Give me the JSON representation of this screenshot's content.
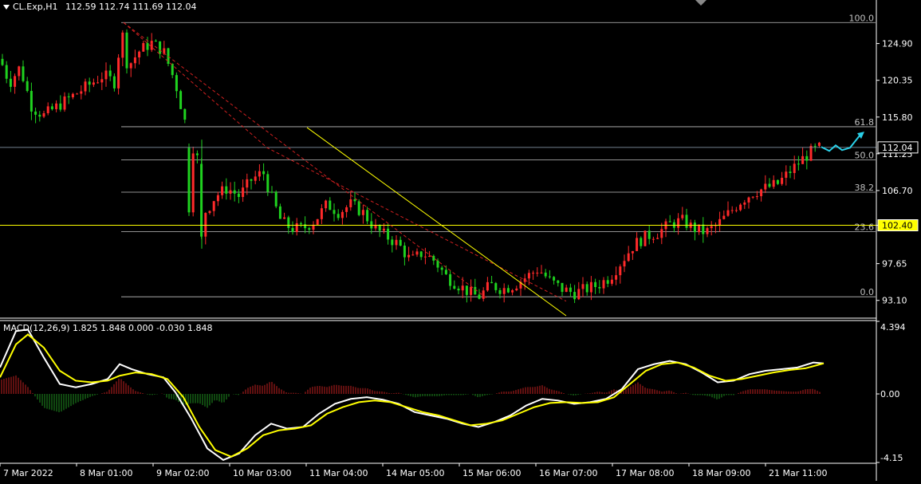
{
  "header": {
    "symbol": "CL.Exp,H1",
    "ohlc": "112.59 112.74 111.69 112.04"
  },
  "macd_header": "MACD(12,26,9) 1.825 1.848 0.000 -0.030 1.848",
  "colors": {
    "background": "#000000",
    "bull_candle": "#ff2a2a",
    "bear_candle": "#1fd21f",
    "grid": "#c0c0c0",
    "yellow": "#ffff00",
    "macd_main": "#ffffff",
    "macd_signal": "#ffff00",
    "macd_pos": "#c02020",
    "macd_neg": "#1f8f1f",
    "projection": "#2ad0e8"
  },
  "chart_data": [
    {
      "type": "candlestick",
      "instrument": "CL.Exp",
      "timeframe": "H1",
      "ylim": [
        91.0,
        129.5
      ],
      "y_ticks": [
        "124.90",
        "120.35",
        "115.80",
        "111.25",
        "106.70",
        "102.40",
        "97.65",
        "93.10"
      ],
      "price_tags": [
        {
          "label": "112.04",
          "value": 112.04
        },
        {
          "label": "102.40",
          "value": 102.4
        }
      ],
      "x_ticks": [
        "7 Mar 2022",
        "8 Mar 01:00",
        "9 Mar 02:00",
        "10 Mar 03:00",
        "11 Mar 04:00",
        "14 Mar 05:00",
        "15 Mar 06:00",
        "16 Mar 07:00",
        "17 Mar 08:00",
        "18 Mar 09:00",
        "21 Mar 11:00"
      ],
      "fibonacci": {
        "high": 127.5,
        "low": 93.55,
        "levels": [
          {
            "label": "100.0",
            "value": 127.5
          },
          {
            "label": "61.8",
            "value": 114.6
          },
          {
            "label": "50.0",
            "value": 110.5
          },
          {
            "label": "38.2",
            "value": 106.5
          },
          {
            "label": "23.6",
            "value": 101.6
          },
          {
            "label": "0.0",
            "value": 93.55
          }
        ]
      },
      "close_path": [
        [
          0,
          123
        ],
        [
          12,
          120
        ],
        [
          25,
          122
        ],
        [
          40,
          117
        ],
        [
          55,
          116
        ],
        [
          70,
          117
        ],
        [
          85,
          118
        ],
        [
          100,
          119
        ],
        [
          115,
          120
        ],
        [
          130,
          121
        ],
        [
          145,
          120
        ],
        [
          152,
          127
        ],
        [
          160,
          122
        ],
        [
          175,
          124
        ],
        [
          190,
          125
        ],
        [
          205,
          124
        ],
        [
          220,
          120
        ],
        [
          235,
          114
        ],
        [
          250,
          110
        ],
        [
          258,
          104
        ],
        [
          270,
          106
        ],
        [
          285,
          107
        ],
        [
          300,
          106
        ],
        [
          315,
          108
        ],
        [
          330,
          109
        ],
        [
          340,
          106
        ],
        [
          352,
          103
        ],
        [
          365,
          102
        ],
        [
          380,
          102
        ],
        [
          395,
          103
        ],
        [
          410,
          105
        ],
        [
          425,
          104
        ],
        [
          440,
          105
        ],
        [
          455,
          104
        ],
        [
          470,
          102
        ],
        [
          485,
          101
        ],
        [
          500,
          100
        ],
        [
          515,
          98
        ],
        [
          530,
          99
        ],
        [
          545,
          98
        ],
        [
          560,
          96
        ],
        [
          575,
          95
        ],
        [
          590,
          94
        ],
        [
          600,
          93.5
        ],
        [
          615,
          95
        ],
        [
          630,
          94.5
        ],
        [
          645,
          95
        ],
        [
          660,
          96
        ],
        [
          675,
          97
        ],
        [
          690,
          95.5
        ],
        [
          705,
          94.5
        ],
        [
          720,
          94
        ],
        [
          735,
          94.5
        ],
        [
          750,
          95
        ],
        [
          765,
          96
        ],
        [
          780,
          98
        ],
        [
          795,
          100
        ],
        [
          810,
          101
        ],
        [
          825,
          101.5
        ],
        [
          840,
          102.5
        ],
        [
          855,
          103
        ],
        [
          870,
          102
        ],
        [
          885,
          101.5
        ],
        [
          900,
          102.5
        ],
        [
          915,
          104
        ],
        [
          930,
          105.5
        ],
        [
          945,
          106.5
        ],
        [
          960,
          107
        ],
        [
          975,
          107.5
        ],
        [
          990,
          109
        ],
        [
          1005,
          110.5
        ],
        [
          1020,
          111.7
        ],
        [
          1030,
          112.04
        ]
      ],
      "fast_drops": [
        [
          238,
          112,
          104
        ],
        [
          253,
          110,
          101
        ]
      ],
      "channel_upper": [
        [
          155,
          127.5
        ],
        [
          335,
          112
        ],
        [
          710,
          93
        ]
      ],
      "channel_lower": [
        [
          610,
          93.4
        ]
      ],
      "trendline": [
        [
          385,
          114.5
        ],
        [
          710,
          91.2
        ]
      ],
      "projection": [
        [
          1030,
          112.1
        ],
        [
          1040,
          111.6
        ],
        [
          1048,
          112.3
        ],
        [
          1056,
          111.7
        ],
        [
          1066,
          112.0
        ],
        [
          1078,
          113.5
        ]
      ]
    },
    {
      "type": "macd",
      "params": "12,26,9",
      "ylim": [
        -4.15,
        4.394
      ],
      "y_ticks": [
        "4.394",
        "0.00",
        "-4.15"
      ],
      "main": [
        [
          0,
          1.6
        ],
        [
          20,
          3.8
        ],
        [
          35,
          3.9
        ],
        [
          55,
          2.2
        ],
        [
          75,
          0.6
        ],
        [
          95,
          0.4
        ],
        [
          115,
          0.6
        ],
        [
          135,
          0.9
        ],
        [
          150,
          1.8
        ],
        [
          165,
          1.5
        ],
        [
          185,
          1.2
        ],
        [
          205,
          1.0
        ],
        [
          220,
          0.1
        ],
        [
          240,
          -1.5
        ],
        [
          260,
          -3.3
        ],
        [
          280,
          -4.0
        ],
        [
          300,
          -3.6
        ],
        [
          320,
          -2.5
        ],
        [
          340,
          -1.8
        ],
        [
          360,
          -2.1
        ],
        [
          380,
          -2.0
        ],
        [
          400,
          -1.2
        ],
        [
          420,
          -0.6
        ],
        [
          440,
          -0.3
        ],
        [
          460,
          -0.2
        ],
        [
          480,
          -0.35
        ],
        [
          500,
          -0.6
        ],
        [
          520,
          -1.1
        ],
        [
          540,
          -1.3
        ],
        [
          560,
          -1.5
        ],
        [
          580,
          -1.8
        ],
        [
          600,
          -2.0
        ],
        [
          620,
          -1.7
        ],
        [
          640,
          -1.3
        ],
        [
          660,
          -0.7
        ],
        [
          680,
          -0.3
        ],
        [
          700,
          -0.4
        ],
        [
          720,
          -0.6
        ],
        [
          740,
          -0.5
        ],
        [
          760,
          -0.3
        ],
        [
          780,
          0.3
        ],
        [
          800,
          1.5
        ],
        [
          820,
          1.8
        ],
        [
          840,
          2.0
        ],
        [
          860,
          1.8
        ],
        [
          880,
          1.3
        ],
        [
          900,
          0.7
        ],
        [
          920,
          0.8
        ],
        [
          940,
          1.2
        ],
        [
          960,
          1.4
        ],
        [
          980,
          1.5
        ],
        [
          1000,
          1.6
        ],
        [
          1020,
          1.9
        ],
        [
          1033,
          1.85
        ]
      ],
      "signal": [
        [
          0,
          1.0
        ],
        [
          20,
          3.0
        ],
        [
          35,
          3.6
        ],
        [
          55,
          2.8
        ],
        [
          75,
          1.4
        ],
        [
          95,
          0.8
        ],
        [
          115,
          0.7
        ],
        [
          135,
          0.8
        ],
        [
          150,
          1.1
        ],
        [
          170,
          1.3
        ],
        [
          190,
          1.2
        ],
        [
          210,
          0.9
        ],
        [
          230,
          -0.2
        ],
        [
          250,
          -2.0
        ],
        [
          270,
          -3.4
        ],
        [
          290,
          -3.8
        ],
        [
          310,
          -3.3
        ],
        [
          330,
          -2.5
        ],
        [
          350,
          -2.2
        ],
        [
          370,
          -2.1
        ],
        [
          390,
          -1.9
        ],
        [
          410,
          -1.2
        ],
        [
          430,
          -0.8
        ],
        [
          450,
          -0.5
        ],
        [
          470,
          -0.4
        ],
        [
          490,
          -0.5
        ],
        [
          510,
          -0.8
        ],
        [
          530,
          -1.1
        ],
        [
          550,
          -1.3
        ],
        [
          570,
          -1.6
        ],
        [
          590,
          -1.9
        ],
        [
          610,
          -1.8
        ],
        [
          630,
          -1.6
        ],
        [
          650,
          -1.2
        ],
        [
          670,
          -0.8
        ],
        [
          690,
          -0.55
        ],
        [
          710,
          -0.5
        ],
        [
          730,
          -0.55
        ],
        [
          750,
          -0.5
        ],
        [
          770,
          -0.2
        ],
        [
          790,
          0.6
        ],
        [
          810,
          1.4
        ],
        [
          830,
          1.8
        ],
        [
          850,
          1.9
        ],
        [
          870,
          1.6
        ],
        [
          890,
          1.1
        ],
        [
          910,
          0.8
        ],
        [
          930,
          0.9
        ],
        [
          950,
          1.1
        ],
        [
          970,
          1.3
        ],
        [
          990,
          1.45
        ],
        [
          1010,
          1.55
        ],
        [
          1033,
          1.85
        ]
      ]
    }
  ]
}
